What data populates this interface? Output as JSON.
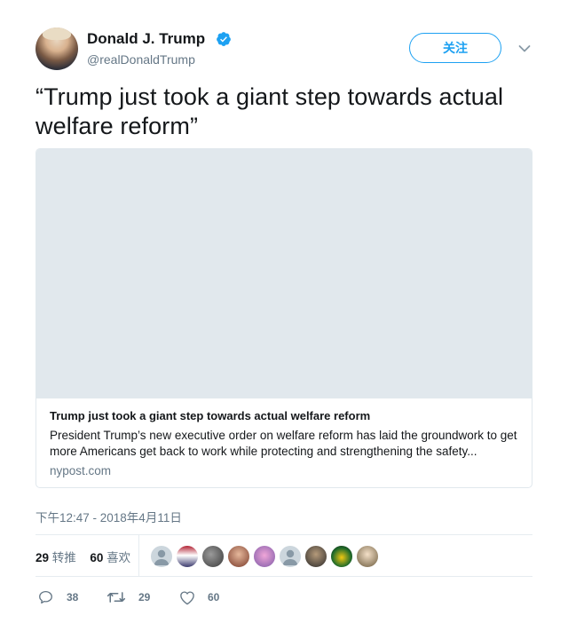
{
  "author": {
    "name": "Donald J. Trump",
    "handle": "@realDonaldTrump",
    "verified_color": "#1da1f2"
  },
  "follow_label": "关注",
  "tweet_text": "“Trump just took a giant step towards actual welfare reform”",
  "card": {
    "title": "Trump just took a giant step towards actual welfare reform",
    "description": "President Trump’s new executive order on welfare reform has laid the groundwork to get more Americans get back to work while protecting and strengthening the safety...",
    "domain": "nypost.com"
  },
  "timestamp": "下午12:47 - 2018年4月11日",
  "stats": {
    "retweets_count": "29",
    "retweets_label": "转推",
    "likes_count": "60",
    "likes_label": "喜欢"
  },
  "actions": {
    "reply_count": "38",
    "retweet_count": "29",
    "like_count": "60"
  },
  "colors": {
    "accent": "#1da1f2",
    "muted": "#657786",
    "card_image_bg": "#e1e8ed"
  }
}
